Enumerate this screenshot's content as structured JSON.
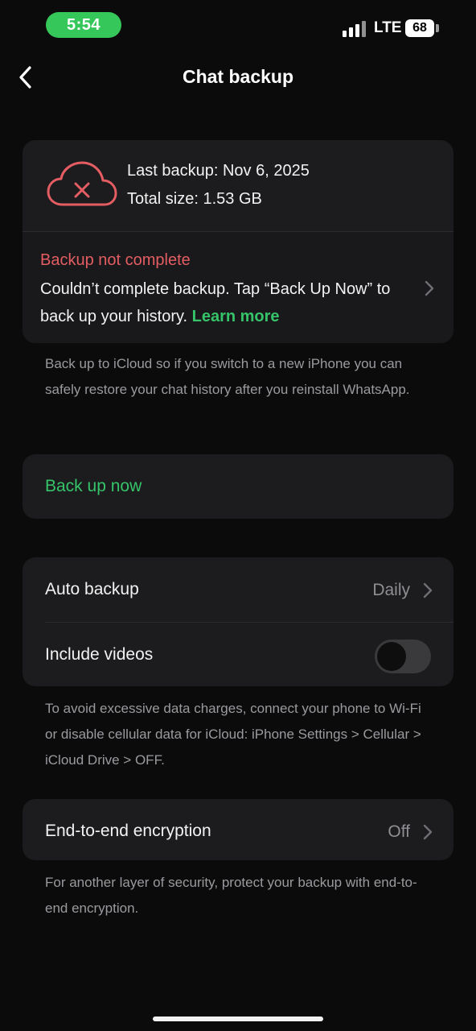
{
  "status_bar": {
    "time": "5:54",
    "network": "LTE",
    "battery": "68"
  },
  "header": {
    "title": "Chat backup"
  },
  "backup_info": {
    "last_backup": "Last backup: Nov 6, 2025",
    "total_size": "Total size: 1.53 GB",
    "error_title": "Backup not complete",
    "error_message": "Couldn’t complete backup. Tap “Back Up Now” to back up your history.",
    "learn_more": "Learn more"
  },
  "icloud_note": "Back up to iCloud so if you switch to a new iPhone you can safely restore your chat history after you reinstall WhatsApp.",
  "back_up_now": "Back up now",
  "settings": {
    "auto_backup": {
      "label": "Auto backup",
      "value": "Daily"
    },
    "include_videos": {
      "label": "Include videos",
      "enabled": false
    }
  },
  "data_note": "To avoid excessive data charges, connect your phone to Wi-Fi or disable cellular data for iCloud: iPhone Settings > Cellular > iCloud Drive > OFF.",
  "encryption": {
    "label": "End-to-end encryption",
    "value": "Off"
  },
  "encryption_note": "For another layer of security, protect your backup with end-to-end encryption.",
  "colors": {
    "accent_green": "#36c46a",
    "error_red": "#e35d63",
    "status_green": "#35c759"
  }
}
